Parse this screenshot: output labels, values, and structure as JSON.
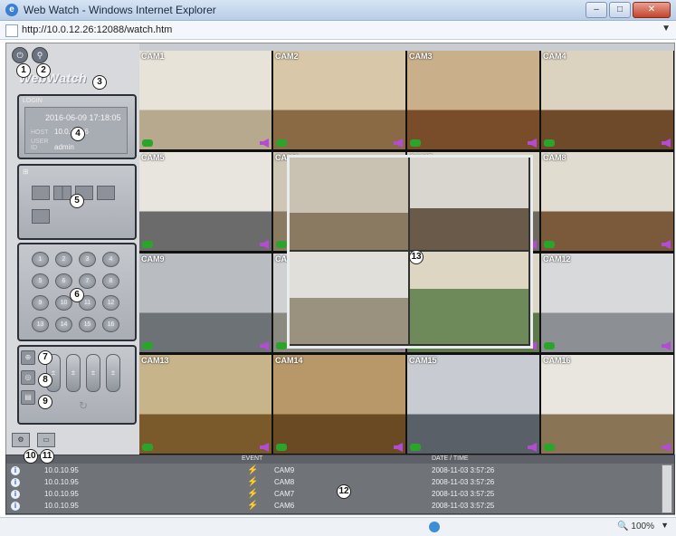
{
  "browser": {
    "title": "Web Watch - Windows Internet Explorer",
    "url": "http://10.0.12.26:12088/watch.htm",
    "zoom": "100%"
  },
  "app": {
    "brand": "WebWatch",
    "login": {
      "header": "LOGIN",
      "datetime": "2016-06-09 17:18:05",
      "ip_key": "HOST",
      "ip": "10.0.12.26",
      "user_key": "USER ID",
      "user": "admin"
    },
    "channels": [
      "1",
      "2",
      "3",
      "4",
      "5",
      "6",
      "7",
      "8",
      "9",
      "10",
      "11",
      "12",
      "13",
      "14",
      "15",
      "16"
    ],
    "cameras": [
      "CAM1",
      "CAM2",
      "CAM3",
      "CAM4",
      "CAM5",
      "CAM6",
      "CAM7",
      "CAM8",
      "CAM9",
      "CAM10",
      "CAM11",
      "CAM12",
      "CAM13",
      "CAM14",
      "CAM15",
      "CAM16"
    ]
  },
  "markers": [
    "1",
    "2",
    "3",
    "4",
    "5",
    "6",
    "7",
    "8",
    "9",
    "10",
    "11",
    "12",
    "13"
  ],
  "eventlog": {
    "header_event": "EVENT",
    "header_datetime": "DATE / TIME",
    "rows": [
      {
        "ip": "10.0.10.95",
        "cam": "CAM9",
        "dt": "2008-11-03 3:57:26"
      },
      {
        "ip": "10.0.10.95",
        "cam": "CAM8",
        "dt": "2008-11-03 3:57:26"
      },
      {
        "ip": "10.0.10.95",
        "cam": "CAM7",
        "dt": "2008-11-03 3:57:25"
      },
      {
        "ip": "10.0.10.95",
        "cam": "CAM6",
        "dt": "2008-11-03 3:57:25"
      }
    ]
  }
}
